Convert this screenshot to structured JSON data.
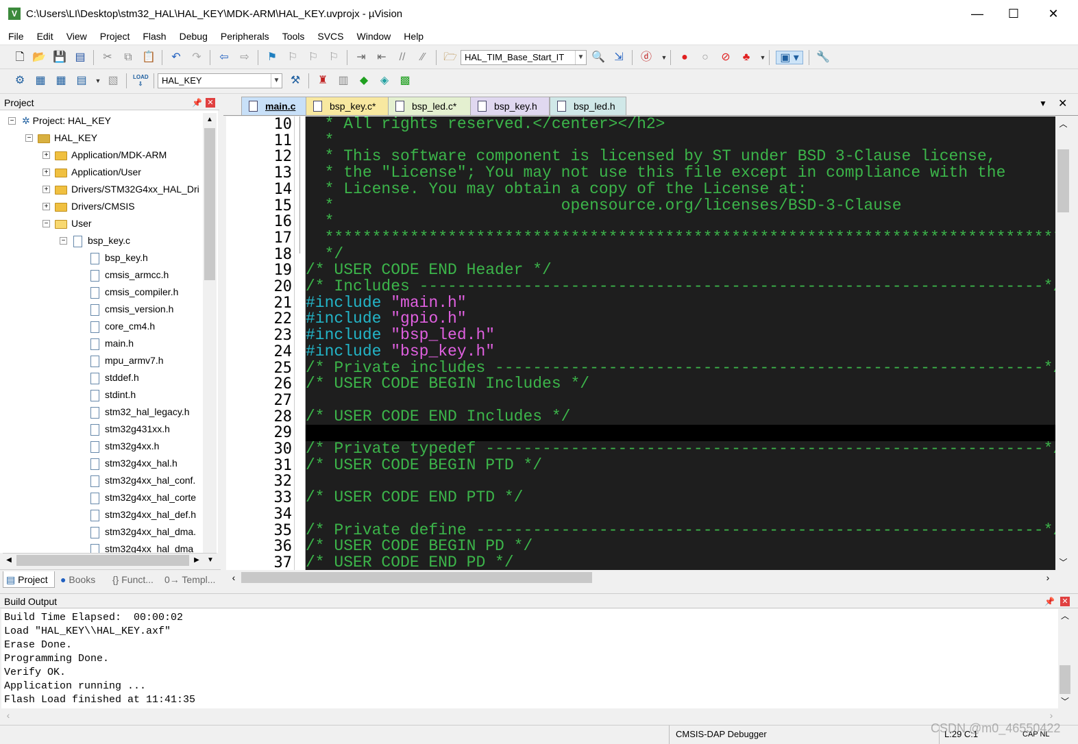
{
  "window": {
    "title": "C:\\Users\\LI\\Desktop\\stm32_HAL\\HAL_KEY\\MDK-ARM\\HAL_KEY.uvprojx - µVision",
    "icon_text": "V",
    "minimize": "—",
    "maximize": "☐",
    "close": "✕"
  },
  "menu": [
    "File",
    "Edit",
    "View",
    "Project",
    "Flash",
    "Debug",
    "Peripherals",
    "Tools",
    "SVCS",
    "Window",
    "Help"
  ],
  "toolbar1": {
    "combo_value": "HAL_TIM_Base_Start_IT"
  },
  "toolbar2": {
    "target_value": "HAL_KEY",
    "load_label": "LOAD"
  },
  "project_panel": {
    "title": "Project",
    "tree": {
      "root": "Project: HAL_KEY",
      "target": "HAL_KEY",
      "groups": [
        "Application/MDK-ARM",
        "Application/User",
        "Drivers/STM32G4xx_HAL_Dri",
        "Drivers/CMSIS",
        "User"
      ],
      "open_file": "bsp_key.c",
      "includes": [
        "bsp_key.h",
        "cmsis_armcc.h",
        "cmsis_compiler.h",
        "cmsis_version.h",
        "core_cm4.h",
        "main.h",
        "mpu_armv7.h",
        "stddef.h",
        "stdint.h",
        "stm32_hal_legacy.h",
        "stm32g431xx.h",
        "stm32g4xx.h",
        "stm32g4xx_hal.h",
        "stm32g4xx_hal_conf.",
        "stm32g4xx_hal_corte",
        "stm32g4xx_hal_def.h",
        "stm32g4xx_hal_dma.",
        "stm32g4xx_hal_dma"
      ]
    },
    "bottom_tabs": [
      "Project",
      "Books",
      "{} Funct...",
      "0→ Templ..."
    ]
  },
  "editor": {
    "tabs": [
      {
        "label": "main.c",
        "active": true
      },
      {
        "label": "bsp_key.c*",
        "active": false
      },
      {
        "label": "bsp_led.c*",
        "active": false
      },
      {
        "label": "bsp_key.h",
        "active": false
      },
      {
        "label": "bsp_led.h",
        "active": false
      }
    ],
    "line_numbers": [
      "10",
      "11",
      "12",
      "13",
      "14",
      "15",
      "16",
      "17",
      "18",
      "19",
      "20",
      "21",
      "22",
      "23",
      "24",
      "25",
      "26",
      "27",
      "28",
      "29",
      "30",
      "31",
      "32",
      "33",
      "34",
      "35",
      "36",
      "37"
    ],
    "lines": [
      "  * All rights reserved.</center></h2>",
      "  *",
      "  * This software component is licensed by ST under BSD 3-Clause license,",
      "  * the \"License\"; You may not use this file except in compliance with the",
      "  * License. You may obtain a copy of the License at:",
      "  *                        opensource.org/licenses/BSD-3-Clause",
      "  *",
      "  ******************************************************************************",
      "  */",
      "/* USER CODE END Header */",
      "/* Includes ------------------------------------------------------------------*/",
      "",
      "",
      "",
      "",
      "/* Private includes ----------------------------------------------------------*/",
      "/* USER CODE BEGIN Includes */",
      "",
      "/* USER CODE END Includes */",
      "",
      "/* Private typedef -----------------------------------------------------------*/",
      "/* USER CODE BEGIN PTD */",
      "",
      "/* USER CODE END PTD */",
      "",
      "/* Private define ------------------------------------------------------------*/",
      "/* USER CODE BEGIN PD */",
      "/* USER CODE END PD */"
    ],
    "includes": [
      {
        "directive": "#include",
        "file": "\"main.h\""
      },
      {
        "directive": "#include",
        "file": "\"gpio.h\""
      },
      {
        "directive": "#include",
        "file": "\"bsp_led.h\""
      },
      {
        "directive": "#include",
        "file": "\"bsp_key.h\""
      }
    ]
  },
  "build_output": {
    "title": "Build Output",
    "lines": [
      "Build Time Elapsed:  00:00:02",
      "Load \"HAL_KEY\\\\HAL_KEY.axf\"",
      "Erase Done.",
      "Programming Done.",
      "Verify OK.",
      "Application running ...",
      "Flash Load finished at 11:41:35"
    ]
  },
  "status": {
    "debugger": "CMSIS-DAP Debugger",
    "position": "L:29 C:1",
    "caps": "CAP NL",
    "watermark": "CSDN @m0_46550422"
  },
  "colors": {
    "editor_bg": "#1e1e1e",
    "comment": "#3cb54a",
    "keyword": "#23b5c8",
    "string": "#e060e0",
    "active_tab": "#c8e0f8",
    "modified_tab": "#f8e8a0"
  },
  "icons": [
    "new-file-icon",
    "open-icon",
    "save-icon",
    "save-all-icon",
    "cut-icon",
    "copy-icon",
    "paste-icon",
    "undo-icon",
    "redo-icon",
    "back-icon",
    "forward-icon",
    "bookmark-icon",
    "indent-icon",
    "outdent-icon",
    "comment-icon",
    "uncomment-icon",
    "find-in-files-icon",
    "debug-icon",
    "breakpoint-icon",
    "build-icon",
    "rebuild-icon",
    "download-icon",
    "options-icon"
  ]
}
